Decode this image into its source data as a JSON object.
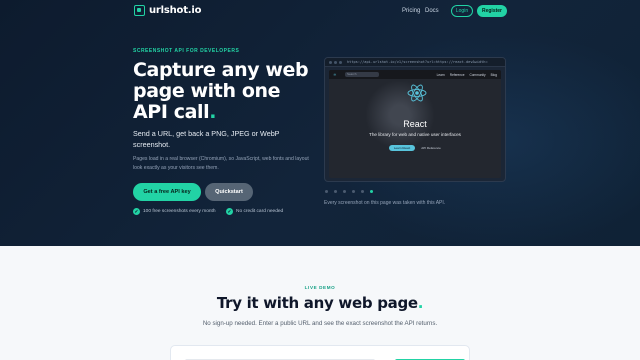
{
  "nav": {
    "logo_text": "urlshot.io",
    "links": [
      "Pricing",
      "Docs"
    ],
    "login": "Login",
    "register": "Register"
  },
  "hero": {
    "eyebrow": "SCREENSHOT API FOR DEVELOPERS",
    "headline": "Capture any web page with one API call",
    "headline_dot": ".",
    "sub": "Send a URL, get back a PNG, JPEG or WebP screenshot.",
    "desc": "Pages load in a real browser (Chromium), so JavaScript, web fonts and layout look exactly as your visitors see them.",
    "primary_button": "Get a free API key",
    "secondary_button": "Quickstart",
    "checks": [
      "100 free screenshots every month",
      "No credit card needed"
    ]
  },
  "preview": {
    "url": "https://api.urlshot.io/v1/screenshot?url=https://react.dev&width=",
    "site": {
      "logo": "React",
      "search_placeholder": "Search",
      "nav_links": [
        "Learn",
        "Reference",
        "Community",
        "Blog"
      ],
      "title": "React",
      "subtitle": "The library for web and native user interfaces",
      "btn_primary": "Learn React",
      "btn_secondary": "API Reference"
    },
    "carousel_count": 6,
    "carousel_active": 5,
    "caption": "Every screenshot on this page was taken with this API."
  },
  "demo": {
    "eyebrow": "LIVE DEMO",
    "title": "Try it with any web page",
    "title_dot": ".",
    "sub": "No sign-up needed. Enter a public URL and see the exact screenshot the API returns."
  },
  "colors": {
    "accent": "#22d3a5",
    "hero_bg": "#0d1b2e",
    "react_blue": "#58c4dc"
  }
}
